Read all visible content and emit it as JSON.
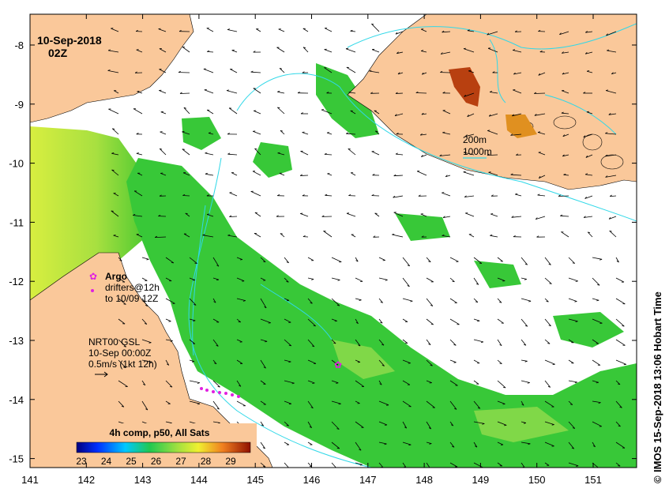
{
  "map": {
    "date": "10-Sep-2018",
    "time": "02Z",
    "x_ticks": [
      "141",
      "142",
      "143",
      "144",
      "145",
      "146",
      "147",
      "148",
      "149",
      "150",
      "151"
    ],
    "y_ticks": [
      "-8",
      "-9",
      "-10",
      "-11",
      "-12",
      "-13",
      "-14",
      "-15"
    ],
    "side_text": "IMOS 15-Sep-2018 13:06 Hobart Time",
    "copyright": "©",
    "contour_legend": {
      "line1": "200m",
      "line2": "1000m"
    },
    "argo": {
      "title": "Argo",
      "line1": "drifters@12h",
      "line2": "to 10/09 12Z"
    },
    "current_legend": {
      "line1": "NRT00 GSL",
      "line2": "10-Sep 00:00Z",
      "line3": "0.5m/s (1kt 12h)"
    },
    "colorbar": {
      "title": "4h comp, p50, All Sats",
      "labels": [
        "23",
        "24",
        "25",
        "26",
        "27",
        "28",
        "29"
      ]
    },
    "colors": {
      "land": "#fac89a",
      "water": "#ffffff",
      "contour": "#30d8e8",
      "argo": "#e020e0",
      "sst_warm_green": "#30c830",
      "sst_yellow": "#d8f040"
    }
  }
}
